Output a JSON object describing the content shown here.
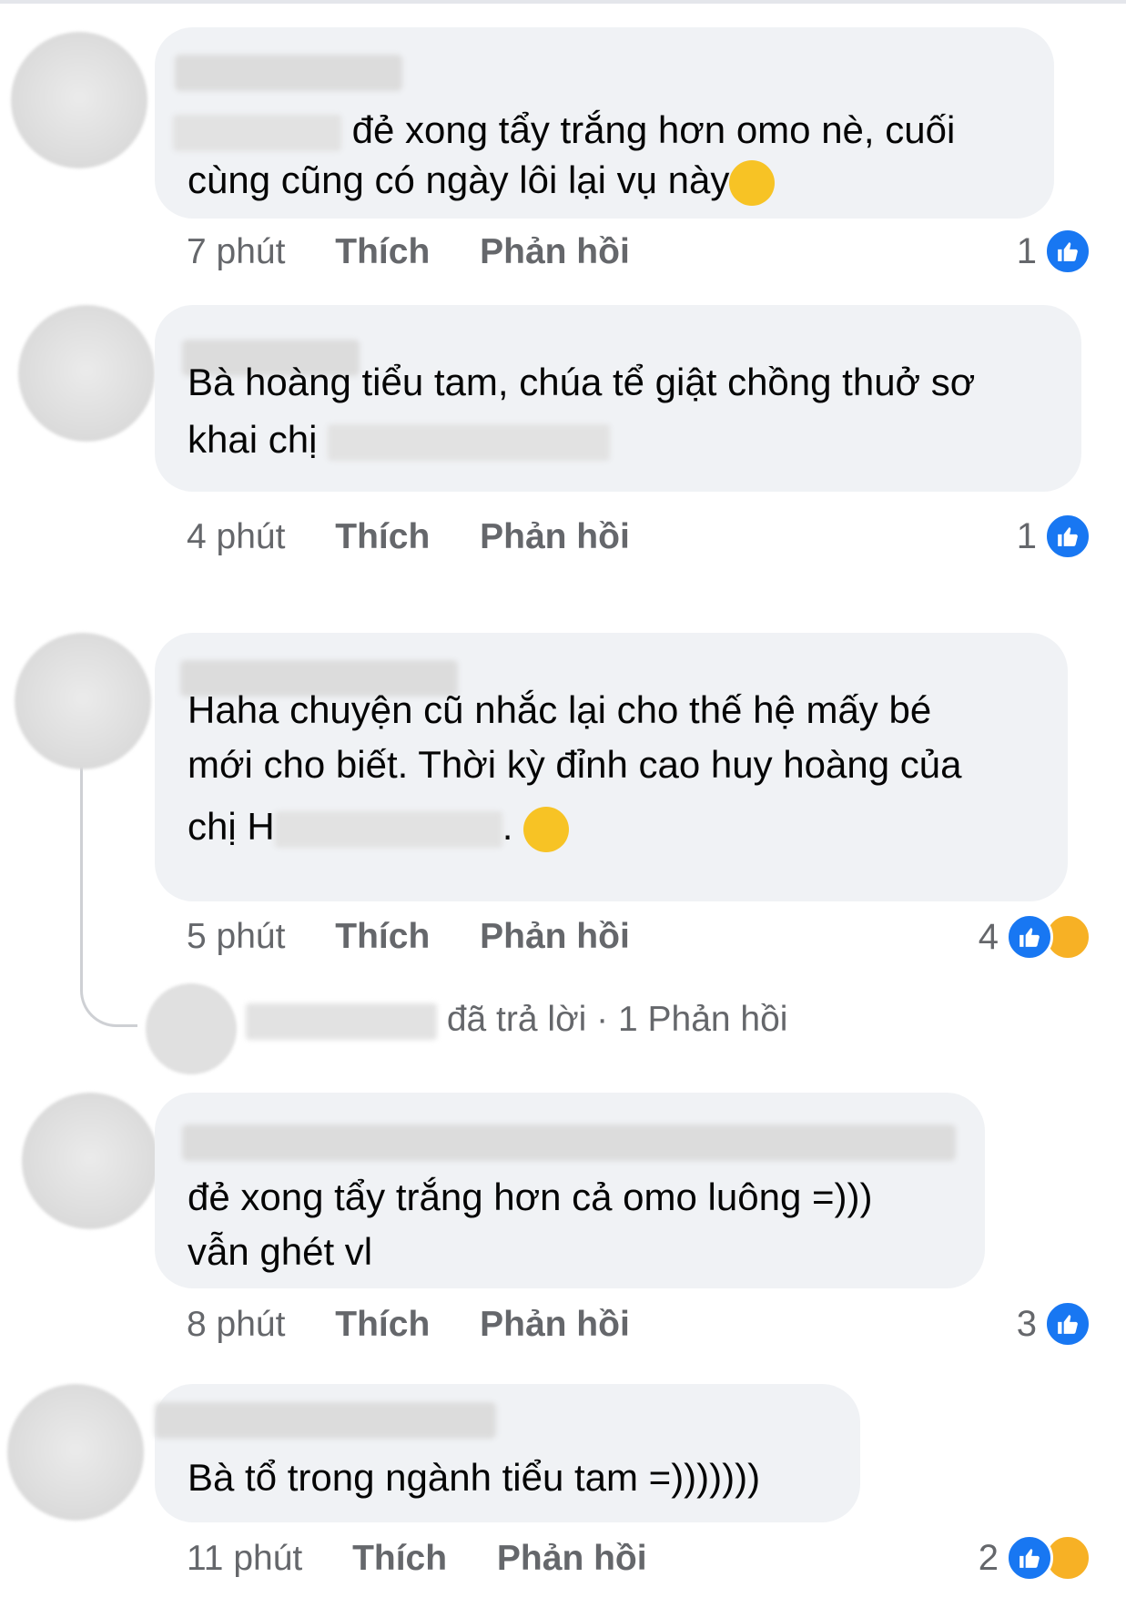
{
  "comments": [
    {
      "text_a": "đẻ xong tẩy trắng hơn omo nè, cuối",
      "text_b": "cùng cũng có ngày lôi lại vụ này",
      "emoji": "rolling-on-floor-laughing",
      "time": "7 phút",
      "like": "Thích",
      "reply": "Phản hồi",
      "count": "1",
      "reactions": [
        "like-icon"
      ]
    },
    {
      "text_a": "Bà hoàng tiểu tam, chúa tể giật chồng thuở sơ",
      "text_b": "khai chị",
      "time": "4 phút",
      "like": "Thích",
      "reply": "Phản hồi",
      "count": "1",
      "reactions": [
        "like-icon"
      ]
    },
    {
      "text_a": "Haha chuyện cũ nhắc lại cho thế hệ mấy bé",
      "text_b": "mới cho biết. Thời kỳ đỉnh cao huy hoàng của",
      "text_c_pre": "chị H",
      "text_c_post": ".",
      "emoji": "tears-of-joy",
      "time": "5 phút",
      "like": "Thích",
      "reply": "Phản hồi",
      "count": "4",
      "reactions": [
        "like-icon",
        "haha-icon"
      ],
      "replies_summary": {
        "who": "",
        "action": "đã trả lời",
        "sep": " · ",
        "count": "1 Phản hồi"
      }
    },
    {
      "text_a": "đẻ xong tẩy trắng hơn cả omo luông =)))",
      "text_b": "vẫn ghét vl",
      "time": "8 phút",
      "like": "Thích",
      "reply": "Phản hồi",
      "count": "3",
      "reactions": [
        "like-icon"
      ]
    },
    {
      "text_a": "Bà tổ trong ngành tiểu tam =)))))))",
      "time": "11 phút",
      "like": "Thích",
      "reply": "Phản hồi",
      "count": "2",
      "reactions": [
        "like-icon",
        "haha-icon"
      ]
    }
  ],
  "colors": {
    "bubble": "#f0f2f5",
    "meta_text": "#65676b",
    "like_blue": "#1877f2",
    "haha_yellow": "#f7b125"
  }
}
